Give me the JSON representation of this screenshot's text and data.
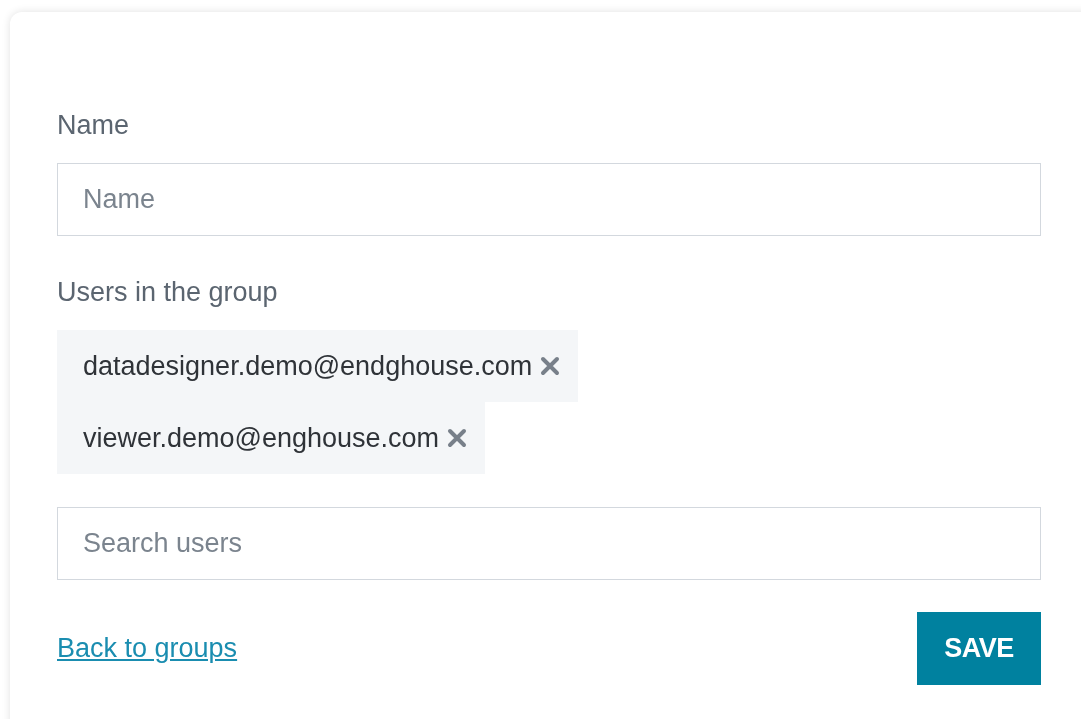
{
  "name_field": {
    "label": "Name",
    "placeholder": "Name"
  },
  "users": {
    "label": "Users in the group",
    "chips": [
      {
        "email": "datadesigner.demo@endghouse.com"
      },
      {
        "email": "viewer.demo@enghouse.com"
      }
    ]
  },
  "search": {
    "placeholder": "Search users"
  },
  "back_link": "Back to groups",
  "save_button": "SAVE"
}
